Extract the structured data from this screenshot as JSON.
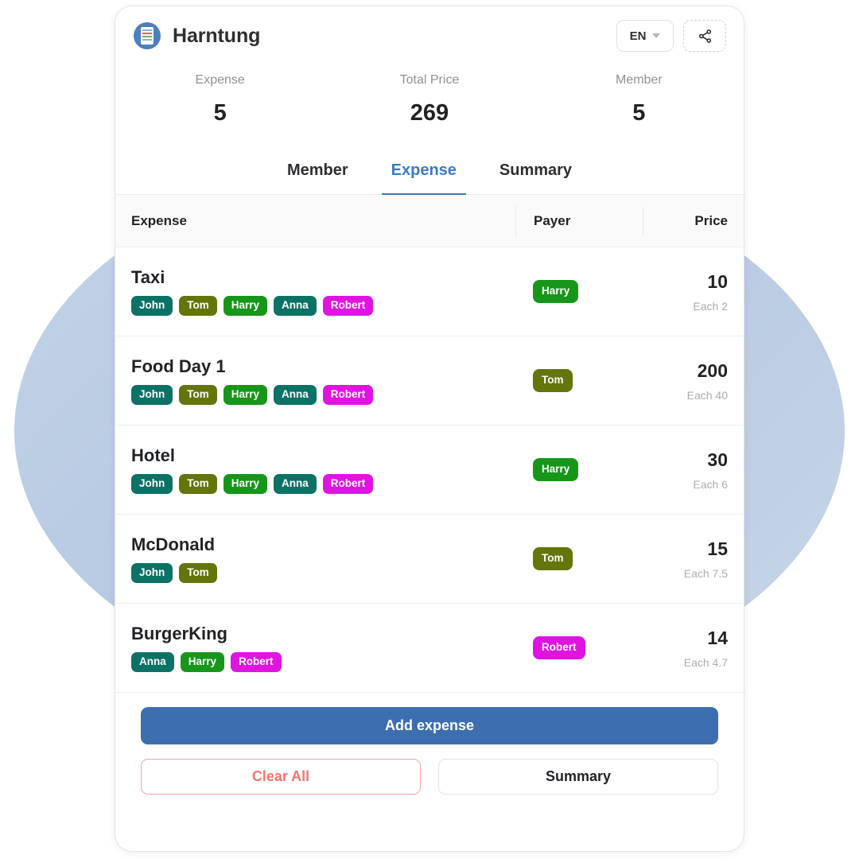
{
  "header": {
    "app_title": "Harntung",
    "app_icon": "receipt-icon",
    "language": "EN",
    "share_icon": "share-nodes-icon"
  },
  "stats": [
    {
      "label": "Expense",
      "value": "5"
    },
    {
      "label": "Total Price",
      "value": "269"
    },
    {
      "label": "Member",
      "value": "5"
    }
  ],
  "tabs": [
    {
      "label": "Member",
      "active": false
    },
    {
      "label": "Expense",
      "active": true
    },
    {
      "label": "Summary",
      "active": false
    }
  ],
  "table": {
    "columns": [
      "Expense",
      "Payer",
      "Price"
    ],
    "rows": [
      {
        "name": "Taxi",
        "members": [
          "John",
          "Tom",
          "Harry",
          "Anna",
          "Robert"
        ],
        "payer": "Harry",
        "price": "10",
        "each": "Each 2"
      },
      {
        "name": "Food Day 1",
        "members": [
          "John",
          "Tom",
          "Harry",
          "Anna",
          "Robert"
        ],
        "payer": "Tom",
        "price": "200",
        "each": "Each 40"
      },
      {
        "name": "Hotel",
        "members": [
          "John",
          "Tom",
          "Harry",
          "Anna",
          "Robert"
        ],
        "payer": "Harry",
        "price": "30",
        "each": "Each 6"
      },
      {
        "name": "McDonald",
        "members": [
          "John",
          "Tom"
        ],
        "payer": "Tom",
        "price": "15",
        "each": "Each 7.5"
      },
      {
        "name": "BurgerKing",
        "members": [
          "Anna",
          "Harry",
          "Robert"
        ],
        "payer": "Robert",
        "price": "14",
        "each": "Each 4.7"
      }
    ]
  },
  "member_colors": {
    "John": "#0b7265",
    "Tom": "#63750b",
    "Harry": "#17961a",
    "Anna": "#0b7265",
    "Robert": "#e014e0"
  },
  "footer": {
    "add_expense": "Add expense",
    "clear_all": "Clear All",
    "summary": "Summary"
  },
  "colors": {
    "accent": "#3b7ac7",
    "primary_button": "#3d6fb0",
    "danger": "#f4756f",
    "background_circle": "#bfd0e6"
  }
}
